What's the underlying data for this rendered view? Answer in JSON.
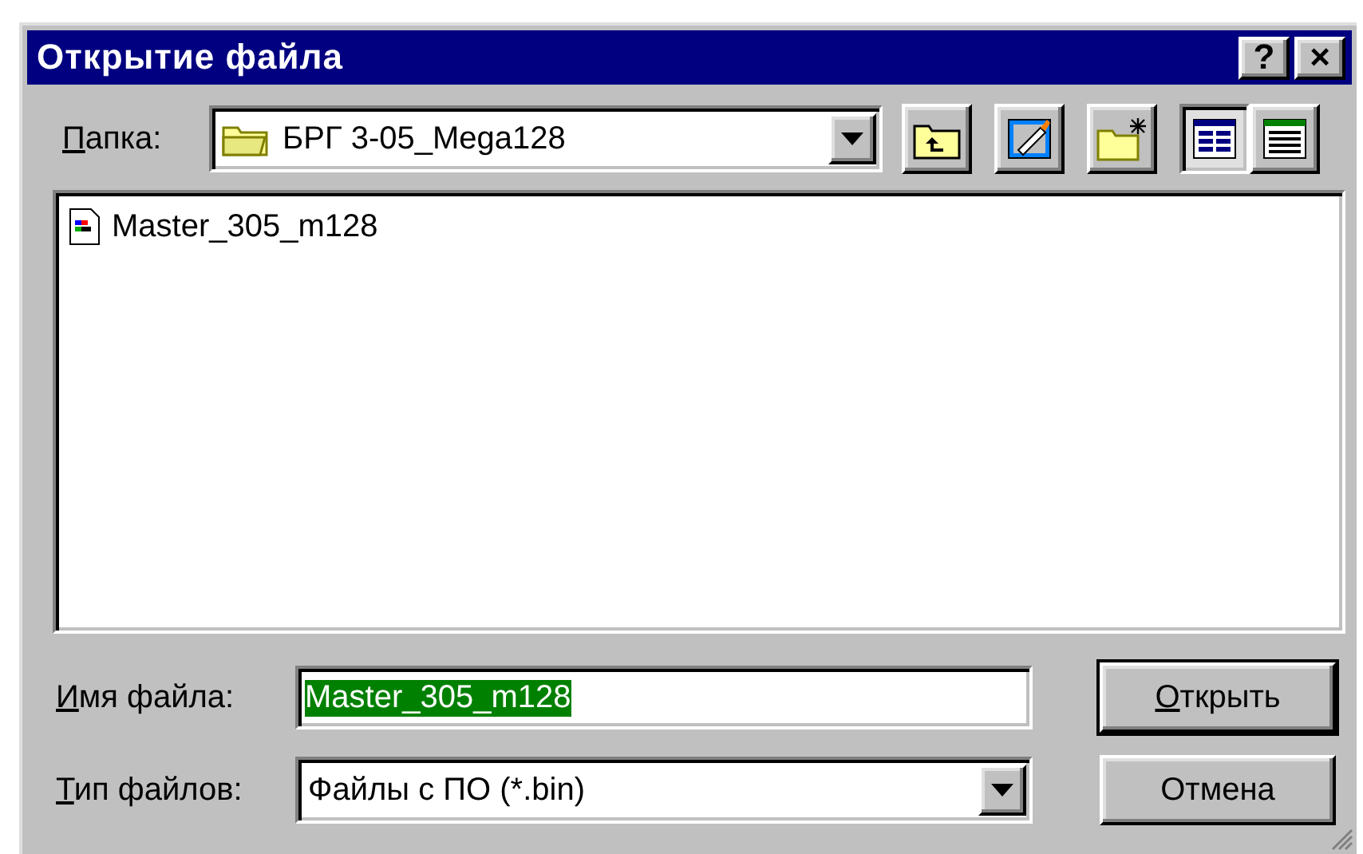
{
  "window": {
    "title": "Открытие файла",
    "buttons": [
      "?",
      "×"
    ]
  },
  "folder": {
    "label": "Папка:",
    "value": "БРГ 3-05_Mega128"
  },
  "toolbar": [
    {
      "kind": "up",
      "selected": false
    },
    {
      "kind": "desktop",
      "selected": false
    },
    {
      "kind": "new-folder",
      "selected": false
    },
    {
      "kind": "list",
      "selected": true
    },
    {
      "kind": "details",
      "selected": false
    }
  ],
  "files": [
    {
      "name": "Master_305_m128",
      "selected": false
    }
  ],
  "file_name": {
    "label": "Имя файла:",
    "value": "Master_305_m128",
    "selected": true
  },
  "file_type": {
    "label": "Тип файлов:",
    "value": "Файлы с ПО (*.bin)"
  },
  "buttons": [
    {
      "label": "Открыть",
      "default": true
    },
    {
      "label": "Отмена",
      "default": false
    }
  ]
}
